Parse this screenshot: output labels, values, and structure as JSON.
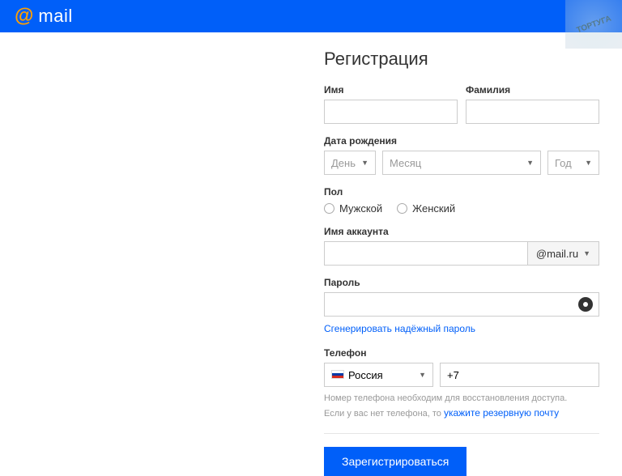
{
  "brand": {
    "at": "@",
    "name": "mail"
  },
  "watermark": "ТОРТУГА",
  "title": "Регистрация",
  "fields": {
    "firstName": "Имя",
    "lastName": "Фамилия",
    "dob": "Дата рождения",
    "dobDay": "День",
    "dobMonth": "Месяц",
    "dobYear": "Год",
    "gender": "Пол",
    "genderMale": "Мужской",
    "genderFemale": "Женский",
    "account": "Имя аккаунта",
    "domain": "@mail.ru",
    "password": "Пароль",
    "genPassword": "Сгенерировать надёжный пароль",
    "phone": "Телефон",
    "country": "Россия",
    "phonePrefix": "+7",
    "hint1": "Номер телефона необходим для восстановления доступа.",
    "hint2a": "Если у вас нет телефона, то ",
    "hint2b": "укажите резервную почту"
  },
  "submit": "Зарегистрироваться"
}
